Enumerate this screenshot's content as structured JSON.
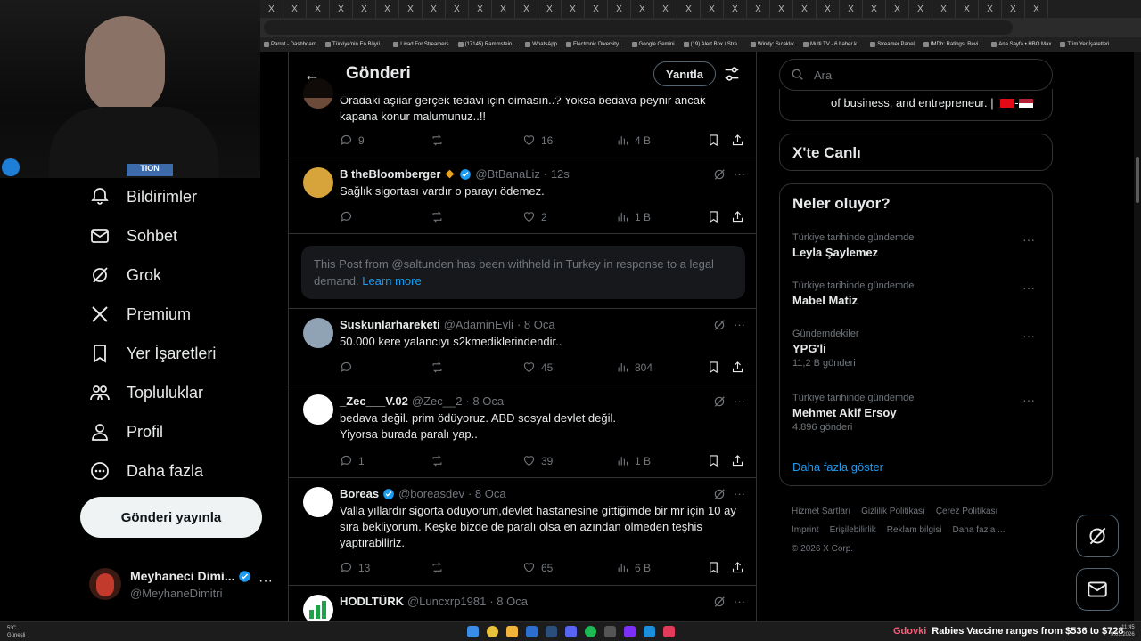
{
  "browser": {
    "tab_glyph": "X",
    "bookmarks": [
      "Parrot - Dashboard",
      "Türkiye'nin En Büyü...",
      "Livad For Streamers",
      "(17145) Rammstein...",
      "WhatsApp",
      "Electronic Diversity...",
      "Google Gemini",
      "(19) Alert Box / Stre...",
      "Windy: Sıcaklık",
      "Multi TV - 6 haber k...",
      "Streamer Panel",
      "IMDb: Ratings, Revi...",
      "Ana Sayfa • HBO Max",
      "Tüm Yer İşaretleri"
    ]
  },
  "webcam": {
    "badge": "TION"
  },
  "nav": {
    "items": [
      "Bildirimler",
      "Sohbet",
      "Grok",
      "Premium",
      "Yer İşaretleri",
      "Topluluklar",
      "Profil",
      "Daha fazla"
    ],
    "post_button": "Gönderi yayınla",
    "profile": {
      "name": "Meyhaneci Dimi...",
      "handle": "@MeyhaneDimitri",
      "more": "···"
    }
  },
  "timeline": {
    "title": "Gönderi",
    "reply_button": "Yanıtla",
    "posts": [
      {
        "name": "",
        "handle": "",
        "date": "",
        "text": "Oradaki aşılar gerçek tedavi için olmasın..? Yoksa bedava peynir ancak kapana konur malumunuz..!!",
        "replies": "9",
        "likes": "16",
        "views": "4 B"
      },
      {
        "name": "B theBloomberger",
        "handle": "@BtBanaLiz",
        "date": "· 12s",
        "text": "Sağlık sigortası vardır o parayı ödemez.",
        "replies": "",
        "likes": "2",
        "views": "1 B"
      },
      {
        "name": "Suskunlarhareketi",
        "handle": "@AdaminEvli",
        "date": "· 8 Oca",
        "text": "50.000 kere yalancıyı s2kmediklerindendir..",
        "replies": "",
        "likes": "45",
        "views": "804"
      },
      {
        "name": "_Zec___V.02",
        "handle": "@Zec__2",
        "date": "· 8 Oca",
        "text": "bedava değil. prim ödüyoruz. ABD sosyal devlet değil.\nYiyorsa burada paralı yap..",
        "replies": "1",
        "likes": "39",
        "views": "1 B"
      },
      {
        "name": "Boreas",
        "handle": "@boreasdev",
        "date": "· 8 Oca",
        "text": "Valla yıllardır sigorta ödüyorum,devlet hastanesine gittiğimde bir mr için 10 ay sıra bekliyorum. Keşke bizde de paralı olsa en azından ölmeden teşhis yaptırabiliriz.",
        "replies": "13",
        "likes": "65",
        "views": "6 B"
      },
      {
        "name": "HODLTÜRK",
        "handle": "@Luncxrp1981",
        "date": "· 8 Oca",
        "text": "",
        "replies": "",
        "likes": "",
        "views": ""
      }
    ],
    "withheld": {
      "text": "This Post from @saltunden has been withheld in Turkey in response to a legal demand.",
      "link": "Learn more"
    }
  },
  "right": {
    "search_placeholder": "Ara",
    "bio_snippet": "of business, and entrepreneur. |",
    "live_title": "X'te Canlı",
    "trends_title": "Neler oluyor?",
    "trends": [
      {
        "context": "Türkiye tarihinde gündemde",
        "name": "Leyla Şaylemez",
        "posts": ""
      },
      {
        "context": "Türkiye tarihinde gündemde",
        "name": "Mabel Matiz",
        "posts": ""
      },
      {
        "context": "Gündemdekiler",
        "name": "YPG'li",
        "posts": "11,2 B gönderi"
      },
      {
        "context": "Türkiye tarihinde gündemde",
        "name": "Mehmet Akif Ersoy",
        "posts": "4.896 gönderi"
      }
    ],
    "show_more": "Daha fazla göster",
    "footer": [
      "Hizmet Şartları",
      "Gizlilik Politikası",
      "Çerez Politikası",
      "Imprint",
      "Erişilebilirlik",
      "Reklam bilgisi",
      "Daha fazla ...",
      "© 2026 X Corp."
    ]
  },
  "taskbar": {
    "weather_temp": "5°C",
    "weather_desc": "Güneşli",
    "ticker_tag": "Gdovki",
    "ticker_text": "Rabies Vaccine ranges from $536 to $728",
    "time": "11:45",
    "date": "9.01.2026"
  },
  "colors": {
    "accent": "#1d9bf0",
    "background": "#000000",
    "border": "#2f3336",
    "muted": "#71767b",
    "verified": "#1d9bf0"
  }
}
